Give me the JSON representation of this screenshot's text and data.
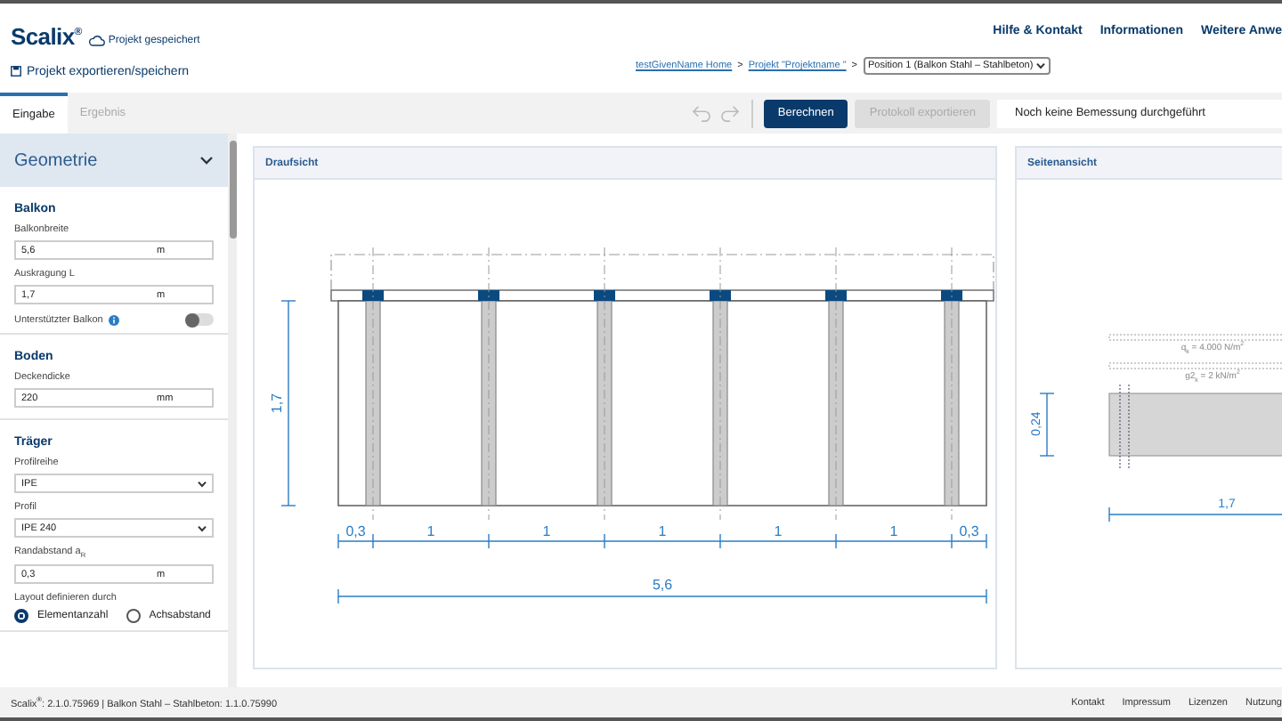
{
  "header": {
    "logo": "Scalix",
    "logo_mark": "®",
    "save_status": "Projekt gespeichert",
    "export_link": "Projekt exportieren/speichern",
    "nav_links": [
      "Hilfe & Kontakt",
      "Informationen",
      "Weitere Anwe"
    ],
    "breadcrumb": [
      {
        "label": "testGivenName Home",
        "kind": "link"
      },
      {
        "label": ">",
        "kind": "separator"
      },
      {
        "label": "Projekt \"Projektname \"",
        "kind": "link"
      },
      {
        "label": ">",
        "kind": "separator"
      }
    ],
    "position_select": "Position 1 (Balkon Stahl – Stahlbeton)"
  },
  "tabs": [
    {
      "label": "Eingabe",
      "selected": true
    },
    {
      "label": "Ergebnis",
      "selected": false
    }
  ],
  "toolbar": {
    "history": [
      {
        "kind": "undo",
        "disabled": true
      },
      {
        "kind": "redo",
        "disabled": true
      }
    ],
    "buttons": [
      {
        "label": "Berechnen",
        "disabled": false
      },
      {
        "label": "Protokoll exportieren",
        "disabled": true
      }
    ],
    "status": "Noch keine Bemessung durchgeführt"
  },
  "sidebar": {
    "section": {
      "title": "Geometrie",
      "expanded": true
    },
    "groups": [
      {
        "title": "Balkon",
        "items": [
          {
            "kind": "input",
            "label": "Balkonbreite",
            "value": "5,6",
            "unit": "m"
          },
          {
            "kind": "input",
            "label": "Auskragung L",
            "value": "1,7",
            "unit": "m"
          },
          {
            "kind": "toggle",
            "label": "Unterstützter Balkon",
            "on": false
          }
        ]
      },
      {
        "title": "Boden",
        "items": [
          {
            "kind": "input",
            "label": "Deckendicke",
            "value": "220",
            "unit": "mm"
          }
        ]
      },
      {
        "title": "Träger",
        "items": [
          {
            "kind": "select",
            "label": "Profilreihe",
            "value": "IPE"
          },
          {
            "kind": "select",
            "label": "Profil",
            "value": "IPE 240"
          },
          {
            "kind": "input",
            "label": "Randabstand a$_{R}$",
            "value": "0,3",
            "unit": "m"
          },
          {
            "kind": "radio",
            "label": "Layout definieren durch",
            "options": [
              {
                "label": "Elementanzahl",
                "selected": true
              },
              {
                "label": "Achsabstand",
                "selected": false
              }
            ]
          }
        ]
      }
    ]
  },
  "top_view": {
    "title": "Draufsicht",
    "depth": "1,7",
    "spacings": [
      "0,3",
      "1",
      "1",
      "1",
      "1",
      "1",
      "0,3"
    ],
    "total": "5,6"
  },
  "side_view": {
    "title": "Seitenansicht",
    "loads": [
      "q$_{k}$ = 4.000 N/m$^{2}$",
      "g2$_{k}$ = 2 kN/m$^{2}$"
    ],
    "thickness": "0,24",
    "length": "1,7"
  },
  "footer": {
    "version": "Scalix$^{®}$: 2.1.0.75969 | Balkon Stahl – Stahlbeton: 1.1.0.75990",
    "links": [
      "Kontakt",
      "Impressum",
      "Lizenzen",
      "Nutzung"
    ]
  }
}
